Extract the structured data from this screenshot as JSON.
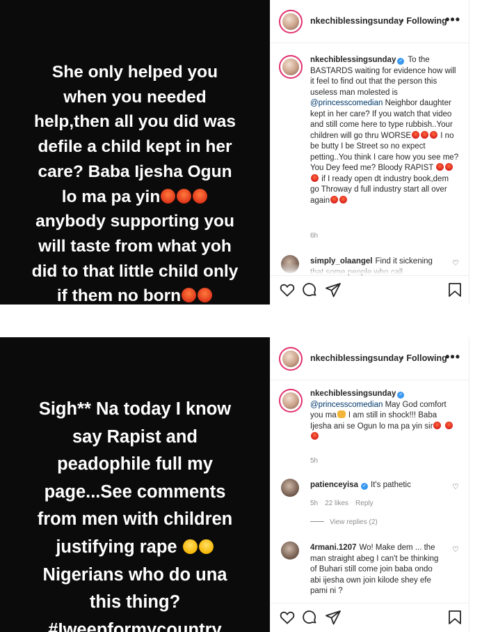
{
  "posts": [
    {
      "story_text": "She only helped you\nwhen you needed\nhelp,then all you did was\ndefile a child kept in her\ncare? Baba Ijesha Ogun\nlo ma pa yin",
      "story_text_2": "anybody supporting you\nwill taste from what yoh\ndid to that little child only\nif them no born",
      "header": {
        "username": "nkechiblessingsunday",
        "follow_label": "Following",
        "more": "•••"
      },
      "caption": {
        "username": "nkechiblessingsunday",
        "part1": "To the BASTARDS waiting for evidence how will it feel to find out that the person this useless man molested is",
        "mention": "@princesscomedian",
        "part2": "Neighbor daughter kept in her care? If you watch that video and still come here to type rubbish..Your children will go thru WORSE",
        "part3": "I no be butty I be Street so no expect petting..You think I care how you see me? You Dey feed me? Bloody RAPIST",
        "part4": "if I ready open dt industry book,dem go Throway d full industry start all over again",
        "time": "6h"
      },
      "comments": [
        {
          "username": "simply_olaangel",
          "text": "Find it sickening that some people who call"
        }
      ]
    },
    {
      "story_text": "Sigh** Na today I know\nsay Rapist and\npeadophile full my\npage...See comments\nfrom men with children\njustifying rape",
      "story_text_2": "Nigerians who do una\nthis thing?\n#Iweepformycountry",
      "header": {
        "username": "nkechiblessingsunday",
        "follow_label": "Following",
        "more": "•••"
      },
      "caption": {
        "username": "nkechiblessingsunday",
        "mention": "@princesscomedian",
        "part1": "May God comfort you ma",
        "part2": "I am still in shock!!! Baba Ijesha ani se Ogun lo ma pa yin sir",
        "time": "5h"
      },
      "comments": [
        {
          "username": "patienceyisa",
          "text": "It's pathetic",
          "time": "5h",
          "likes": "22 likes",
          "reply": "Reply"
        },
        {
          "username": "4rmani.1207",
          "text": "Wo! Make dem ... the man straight abeg I can't be thinking of Buhari still come join baba ondo abi ijesha own join kilode shey efe pami ni ?"
        }
      ],
      "view_replies": "View replies (2)"
    }
  ]
}
